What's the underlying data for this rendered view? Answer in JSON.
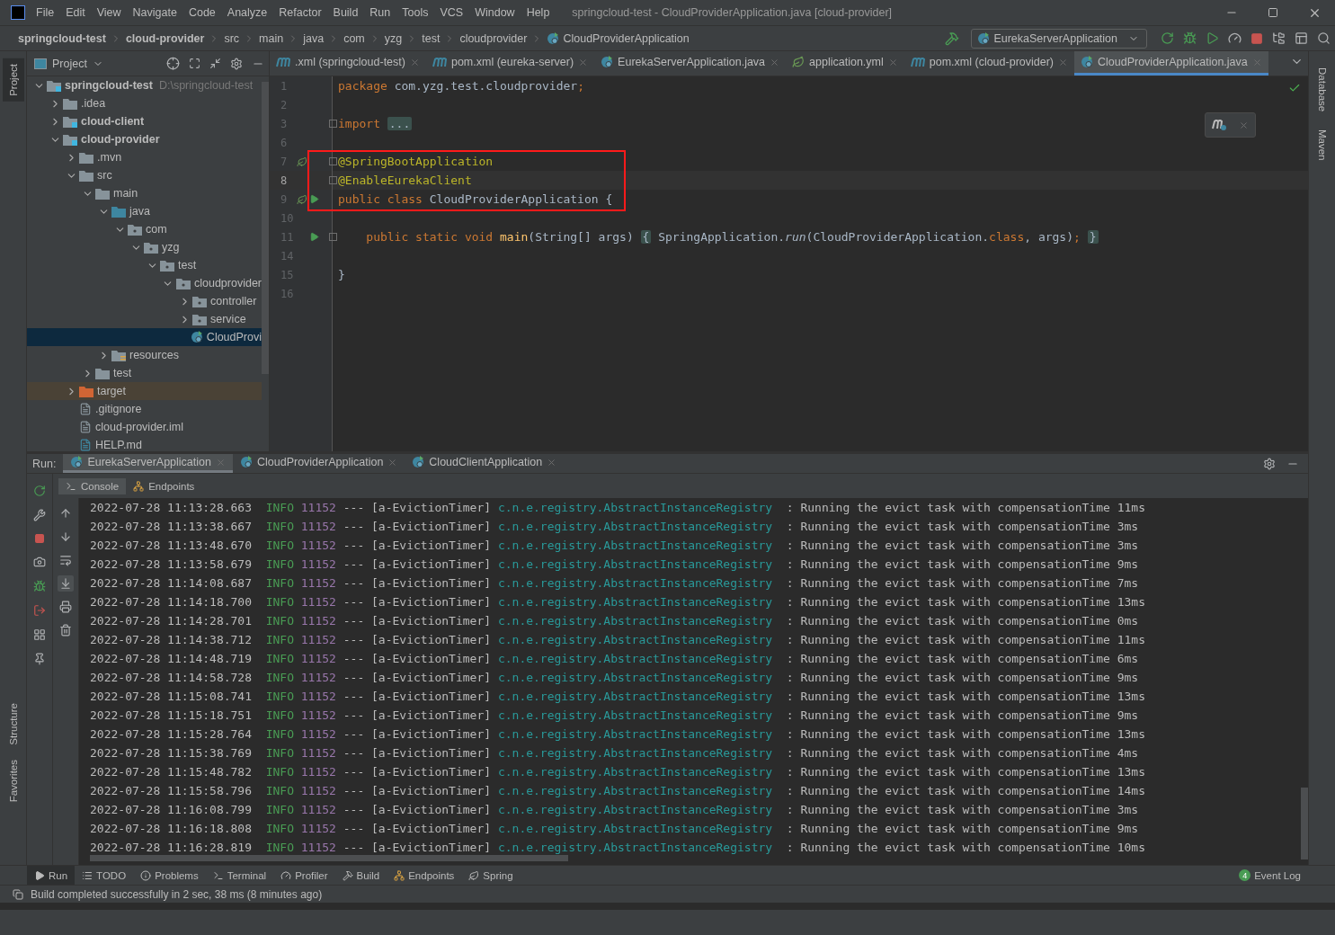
{
  "title_bar": {
    "menus": [
      "File",
      "Edit",
      "View",
      "Navigate",
      "Code",
      "Analyze",
      "Refactor",
      "Build",
      "Run",
      "Tools",
      "VCS",
      "Window",
      "Help"
    ],
    "title": "springcloud-test - CloudProviderApplication.java [cloud-provider]"
  },
  "breadcrumbs": [
    {
      "label": "springcloud-test",
      "kind": "module"
    },
    {
      "label": "cloud-provider",
      "kind": "module"
    },
    {
      "label": "src",
      "kind": "dir"
    },
    {
      "label": "main",
      "kind": "dir"
    },
    {
      "label": "java",
      "kind": "dir"
    },
    {
      "label": "com",
      "kind": "dir"
    },
    {
      "label": "yzg",
      "kind": "dir"
    },
    {
      "label": "test",
      "kind": "dir"
    },
    {
      "label": "cloudprovider",
      "kind": "dir"
    },
    {
      "label": "CloudProviderApplication",
      "kind": "class"
    }
  ],
  "run_config": {
    "label": "EurekaServerApplication"
  },
  "tool_windows": {
    "left_top": [
      {
        "label": "Project",
        "selected": true
      }
    ],
    "left_bottom": [
      {
        "label": "Structure",
        "selected": false
      },
      {
        "label": "Favorites",
        "selected": false
      }
    ],
    "right": [
      {
        "label": "Database",
        "selected": false
      },
      {
        "label": "Maven",
        "selected": false
      }
    ]
  },
  "project_panel": {
    "title": "Project",
    "tree": [
      {
        "label": "springcloud-test",
        "hint": "D:\\springcloud-test",
        "kind": "module",
        "expanded": true,
        "selected": false,
        "children": [
          {
            "label": ".idea",
            "kind": "folder",
            "expanded": false,
            "selected": false
          },
          {
            "label": "cloud-client",
            "kind": "module",
            "expanded": false,
            "selected": false
          },
          {
            "label": "cloud-provider",
            "kind": "module",
            "expanded": true,
            "selected": false,
            "children": [
              {
                "label": ".mvn",
                "kind": "folder",
                "expanded": false,
                "selected": false
              },
              {
                "label": "src",
                "kind": "folder",
                "expanded": true,
                "selected": false,
                "children": [
                  {
                    "label": "main",
                    "kind": "folder",
                    "expanded": true,
                    "selected": false,
                    "children": [
                      {
                        "label": "java",
                        "kind": "source",
                        "expanded": true,
                        "selected": false,
                        "children": [
                          {
                            "label": "com",
                            "kind": "package",
                            "expanded": true,
                            "selected": false,
                            "children": [
                              {
                                "label": "yzg",
                                "kind": "package",
                                "expanded": true,
                                "selected": false,
                                "children": [
                                  {
                                    "label": "test",
                                    "kind": "package",
                                    "expanded": true,
                                    "selected": false,
                                    "children": [
                                      {
                                        "label": "cloudprovider",
                                        "kind": "package",
                                        "expanded": true,
                                        "selected": false,
                                        "children": [
                                          {
                                            "label": "controller",
                                            "kind": "package",
                                            "expanded": false,
                                            "selected": false
                                          },
                                          {
                                            "label": "service",
                                            "kind": "package",
                                            "expanded": false,
                                            "selected": false
                                          },
                                          {
                                            "label": "CloudProvi",
                                            "kind": "spring",
                                            "selected": true
                                          }
                                        ]
                                      }
                                    ]
                                  }
                                ]
                              }
                            ]
                          }
                        ]
                      },
                      {
                        "label": "resources",
                        "kind": "resources",
                        "expanded": false,
                        "selected": false
                      }
                    ]
                  },
                  {
                    "label": "test",
                    "kind": "folder",
                    "expanded": false,
                    "selected": false
                  }
                ]
              },
              {
                "label": "target",
                "kind": "excluded",
                "expanded": false,
                "selected": false
              },
              {
                "label": ".gitignore",
                "kind": "gitignore",
                "selected": false
              },
              {
                "label": "cloud-provider.iml",
                "kind": "iml",
                "selected": false
              },
              {
                "label": "HELP.md",
                "kind": "md",
                "selected": false
              }
            ]
          }
        ]
      }
    ]
  },
  "editor_tabs": [
    {
      "label": ".xml (springcloud-test)",
      "kind": "maven",
      "selected": false
    },
    {
      "label": "pom.xml (eureka-server)",
      "kind": "maven",
      "selected": false
    },
    {
      "label": "EurekaServerApplication.java",
      "kind": "spring",
      "selected": false
    },
    {
      "label": "application.yml",
      "kind": "yml",
      "selected": false
    },
    {
      "label": "pom.xml (cloud-provider)",
      "kind": "maven",
      "selected": false
    },
    {
      "label": "CloudProviderApplication.java",
      "kind": "spring",
      "selected": true
    }
  ],
  "editor": {
    "lines": [
      {
        "number": "1",
        "current": false,
        "boxed": false,
        "fold": false,
        "tokens": [
          {
            "text": "package ",
            "kind": "kw"
          },
          {
            "text": "com.yzg.test.cloudprovider",
            "kind": "plain"
          },
          {
            "text": ";",
            "kind": "kw"
          }
        ]
      },
      {
        "number": "2",
        "current": false,
        "boxed": false,
        "fold": false
      },
      {
        "number": "3",
        "current": false,
        "boxed": false,
        "fold": true,
        "tokens": [
          {
            "text": "import ",
            "kind": "kw"
          },
          {
            "text": "...",
            "kind": "folded"
          }
        ]
      },
      {
        "number": "6",
        "current": false,
        "boxed": false,
        "fold": false
      },
      {
        "number": "7",
        "current": false,
        "boxed": true,
        "fold": true,
        "gutter_icons": [
          {
            "kind": "bean"
          }
        ],
        "tokens": [
          {
            "text": "@SpringBootApplication",
            "kind": "ann"
          }
        ]
      },
      {
        "number": "8",
        "current": true,
        "boxed": true,
        "fold": true,
        "tokens": [
          {
            "text": "@EnableEurekaClient",
            "kind": "ann"
          }
        ]
      },
      {
        "number": "9",
        "current": false,
        "boxed": true,
        "fold": false,
        "gutter_icons": [
          {
            "kind": "bean"
          },
          {
            "kind": "run"
          }
        ],
        "tokens": [
          {
            "text": "public class ",
            "kind": "kw"
          },
          {
            "text": "CloudProviderApplication {",
            "kind": "plain"
          }
        ]
      },
      {
        "number": "10",
        "current": false,
        "boxed": false,
        "fold": false
      },
      {
        "number": "11",
        "current": false,
        "boxed": false,
        "fold": true,
        "gutter_icons": [
          {
            "kind": "run"
          }
        ],
        "tokens": [
          {
            "text": "    public static void ",
            "kind": "kw"
          },
          {
            "text": "main",
            "kind": "fn"
          },
          {
            "text": "(String[] args) ",
            "kind": "plain"
          },
          {
            "text": "{",
            "kind": "folded"
          },
          {
            "text": " SpringApplication.",
            "kind": "plain"
          },
          {
            "text": "run",
            "kind": "italic"
          },
          {
            "text": "(CloudProviderApplication.",
            "kind": "plain"
          },
          {
            "text": "class",
            "kind": "kw"
          },
          {
            "text": ", args)",
            "kind": "plain"
          },
          {
            "text": "; ",
            "kind": "kw"
          },
          {
            "text": "}",
            "kind": "folded"
          }
        ]
      },
      {
        "number": "14",
        "current": false,
        "boxed": false,
        "fold": false
      },
      {
        "number": "15",
        "current": false,
        "boxed": false,
        "fold": false,
        "tokens": [
          {
            "text": "}",
            "kind": "plain"
          }
        ]
      },
      {
        "number": "16",
        "current": false,
        "boxed": false,
        "fold": false
      }
    ]
  },
  "run_panel": {
    "label": "Run:",
    "tabs": [
      {
        "label": "EurekaServerApplication",
        "selected": true
      },
      {
        "label": "CloudProviderApplication",
        "selected": false
      },
      {
        "label": "CloudClientApplication",
        "selected": false
      }
    ],
    "subtabs": [
      {
        "label": "Console",
        "kind": "console",
        "selected": true
      },
      {
        "label": "Endpoints",
        "kind": "endpoints",
        "selected": false
      }
    ],
    "log": [
      {
        "time": "2022-07-28 11:13:28.663",
        "level": "INFO",
        "pid": "11152",
        "sep": "---",
        "thread": "[a-EvictionTimer]",
        "logger": "c.n.e.registry.AbstractInstanceRegistry",
        "message": ": Running the evict task with compensationTime 11ms"
      },
      {
        "time": "2022-07-28 11:13:38.667",
        "level": "INFO",
        "pid": "11152",
        "sep": "---",
        "thread": "[a-EvictionTimer]",
        "logger": "c.n.e.registry.AbstractInstanceRegistry",
        "message": ": Running the evict task with compensationTime 3ms"
      },
      {
        "time": "2022-07-28 11:13:48.670",
        "level": "INFO",
        "pid": "11152",
        "sep": "---",
        "thread": "[a-EvictionTimer]",
        "logger": "c.n.e.registry.AbstractInstanceRegistry",
        "message": ": Running the evict task with compensationTime 3ms"
      },
      {
        "time": "2022-07-28 11:13:58.679",
        "level": "INFO",
        "pid": "11152",
        "sep": "---",
        "thread": "[a-EvictionTimer]",
        "logger": "c.n.e.registry.AbstractInstanceRegistry",
        "message": ": Running the evict task with compensationTime 9ms"
      },
      {
        "time": "2022-07-28 11:14:08.687",
        "level": "INFO",
        "pid": "11152",
        "sep": "---",
        "thread": "[a-EvictionTimer]",
        "logger": "c.n.e.registry.AbstractInstanceRegistry",
        "message": ": Running the evict task with compensationTime 7ms"
      },
      {
        "time": "2022-07-28 11:14:18.700",
        "level": "INFO",
        "pid": "11152",
        "sep": "---",
        "thread": "[a-EvictionTimer]",
        "logger": "c.n.e.registry.AbstractInstanceRegistry",
        "message": ": Running the evict task with compensationTime 13ms"
      },
      {
        "time": "2022-07-28 11:14:28.701",
        "level": "INFO",
        "pid": "11152",
        "sep": "---",
        "thread": "[a-EvictionTimer]",
        "logger": "c.n.e.registry.AbstractInstanceRegistry",
        "message": ": Running the evict task with compensationTime 0ms"
      },
      {
        "time": "2022-07-28 11:14:38.712",
        "level": "INFO",
        "pid": "11152",
        "sep": "---",
        "thread": "[a-EvictionTimer]",
        "logger": "c.n.e.registry.AbstractInstanceRegistry",
        "message": ": Running the evict task with compensationTime 11ms"
      },
      {
        "time": "2022-07-28 11:14:48.719",
        "level": "INFO",
        "pid": "11152",
        "sep": "---",
        "thread": "[a-EvictionTimer]",
        "logger": "c.n.e.registry.AbstractInstanceRegistry",
        "message": ": Running the evict task with compensationTime 6ms"
      },
      {
        "time": "2022-07-28 11:14:58.728",
        "level": "INFO",
        "pid": "11152",
        "sep": "---",
        "thread": "[a-EvictionTimer]",
        "logger": "c.n.e.registry.AbstractInstanceRegistry",
        "message": ": Running the evict task with compensationTime 9ms"
      },
      {
        "time": "2022-07-28 11:15:08.741",
        "level": "INFO",
        "pid": "11152",
        "sep": "---",
        "thread": "[a-EvictionTimer]",
        "logger": "c.n.e.registry.AbstractInstanceRegistry",
        "message": ": Running the evict task with compensationTime 13ms"
      },
      {
        "time": "2022-07-28 11:15:18.751",
        "level": "INFO",
        "pid": "11152",
        "sep": "---",
        "thread": "[a-EvictionTimer]",
        "logger": "c.n.e.registry.AbstractInstanceRegistry",
        "message": ": Running the evict task with compensationTime 9ms"
      },
      {
        "time": "2022-07-28 11:15:28.764",
        "level": "INFO",
        "pid": "11152",
        "sep": "---",
        "thread": "[a-EvictionTimer]",
        "logger": "c.n.e.registry.AbstractInstanceRegistry",
        "message": ": Running the evict task with compensationTime 13ms"
      },
      {
        "time": "2022-07-28 11:15:38.769",
        "level": "INFO",
        "pid": "11152",
        "sep": "---",
        "thread": "[a-EvictionTimer]",
        "logger": "c.n.e.registry.AbstractInstanceRegistry",
        "message": ": Running the evict task with compensationTime 4ms"
      },
      {
        "time": "2022-07-28 11:15:48.782",
        "level": "INFO",
        "pid": "11152",
        "sep": "---",
        "thread": "[a-EvictionTimer]",
        "logger": "c.n.e.registry.AbstractInstanceRegistry",
        "message": ": Running the evict task with compensationTime 13ms"
      },
      {
        "time": "2022-07-28 11:15:58.796",
        "level": "INFO",
        "pid": "11152",
        "sep": "---",
        "thread": "[a-EvictionTimer]",
        "logger": "c.n.e.registry.AbstractInstanceRegistry",
        "message": ": Running the evict task with compensationTime 14ms"
      },
      {
        "time": "2022-07-28 11:16:08.799",
        "level": "INFO",
        "pid": "11152",
        "sep": "---",
        "thread": "[a-EvictionTimer]",
        "logger": "c.n.e.registry.AbstractInstanceRegistry",
        "message": ": Running the evict task with compensationTime 3ms"
      },
      {
        "time": "2022-07-28 11:16:18.808",
        "level": "INFO",
        "pid": "11152",
        "sep": "---",
        "thread": "[a-EvictionTimer]",
        "logger": "c.n.e.registry.AbstractInstanceRegistry",
        "message": ": Running the evict task with compensationTime 9ms"
      },
      {
        "time": "2022-07-28 11:16:28.819",
        "level": "INFO",
        "pid": "11152",
        "sep": "---",
        "thread": "[a-EvictionTimer]",
        "logger": "c.n.e.registry.AbstractInstanceRegistry",
        "message": ": Running the evict task with compensationTime 10ms"
      }
    ]
  },
  "tool_tabs": [
    {
      "label": "Run",
      "kind": "run",
      "selected": true
    },
    {
      "label": "TODO",
      "kind": "todo",
      "selected": false
    },
    {
      "label": "Problems",
      "kind": "problems",
      "selected": false
    },
    {
      "label": "Terminal",
      "kind": "terminal",
      "selected": false
    },
    {
      "label": "Profiler",
      "kind": "profiler",
      "selected": false
    },
    {
      "label": "Build",
      "kind": "build",
      "selected": false
    },
    {
      "label": "Endpoints",
      "kind": "endpoints",
      "selected": false
    },
    {
      "label": "Spring",
      "kind": "spring",
      "selected": false
    }
  ],
  "event_log": {
    "label": "Event Log",
    "count": "4"
  },
  "status": "Build completed successfully in 2 sec, 38 ms (8 minutes ago)"
}
